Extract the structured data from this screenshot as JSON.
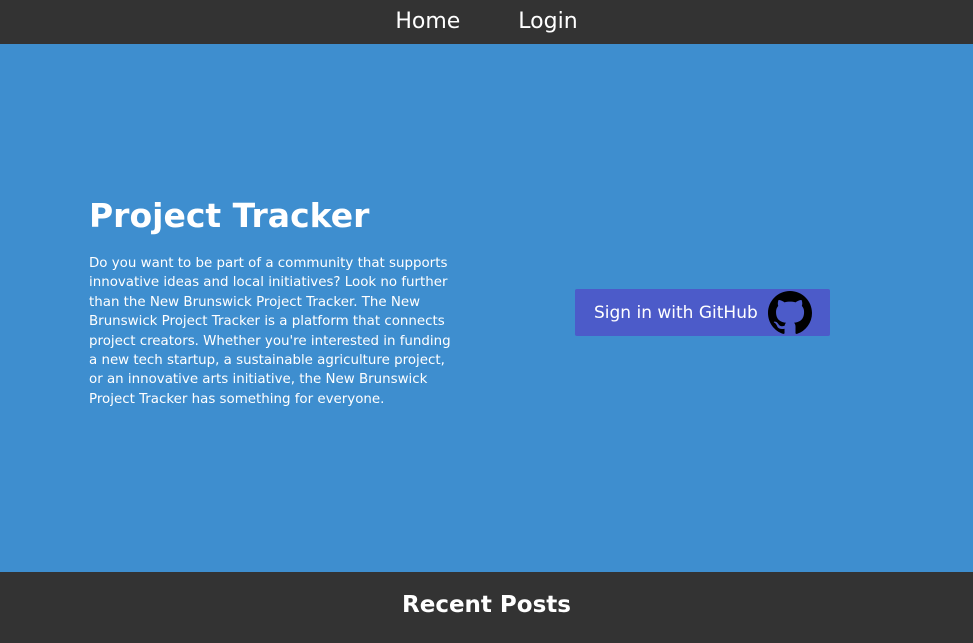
{
  "nav": {
    "home_label": "Home",
    "login_label": "Login"
  },
  "hero": {
    "title": "Project Tracker",
    "description": "Do you want to be part of a community that supports innovative ideas and local initiatives? Look no further than the New Brunswick Project Tracker. The New Brunswick Project Tracker is a platform that connects project creators. Whether you're interested in funding a new tech startup, a sustainable agriculture project, or an innovative arts initiative, the New Brunswick Project Tracker has something for everyone.",
    "github_button_label": "Sign in with GitHub",
    "github_icon": "github-icon"
  },
  "recent": {
    "title": "Recent Posts"
  },
  "colors": {
    "nav_background": "#333333",
    "hero_background": "#3e8ecf",
    "button_background": "#4c5bc9",
    "text": "#ffffff"
  }
}
